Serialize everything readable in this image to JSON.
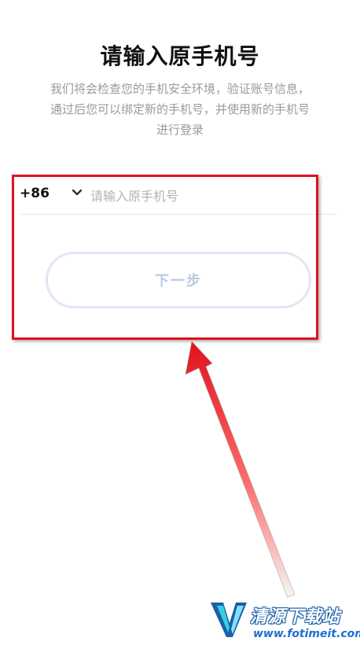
{
  "header": {
    "title": "请输入原手机号"
  },
  "description": {
    "line1": "我们将会检查您的手机安全环境，验证账号信息，",
    "line2": "通过后您可以绑定新的手机号，并使用新的手机号",
    "line3": "进行登录"
  },
  "form": {
    "country_code": "+86",
    "phone_placeholder": "请输入原手机号",
    "phone_value": ""
  },
  "actions": {
    "next_label": "下一步"
  },
  "watermark": {
    "name": "清源下载站",
    "url": "www.fotimeit.com"
  },
  "colors": {
    "annotation_red": "#e0121c",
    "button_border_disabled": "#dfe7f3",
    "button_text_disabled": "#b9c9e2"
  }
}
